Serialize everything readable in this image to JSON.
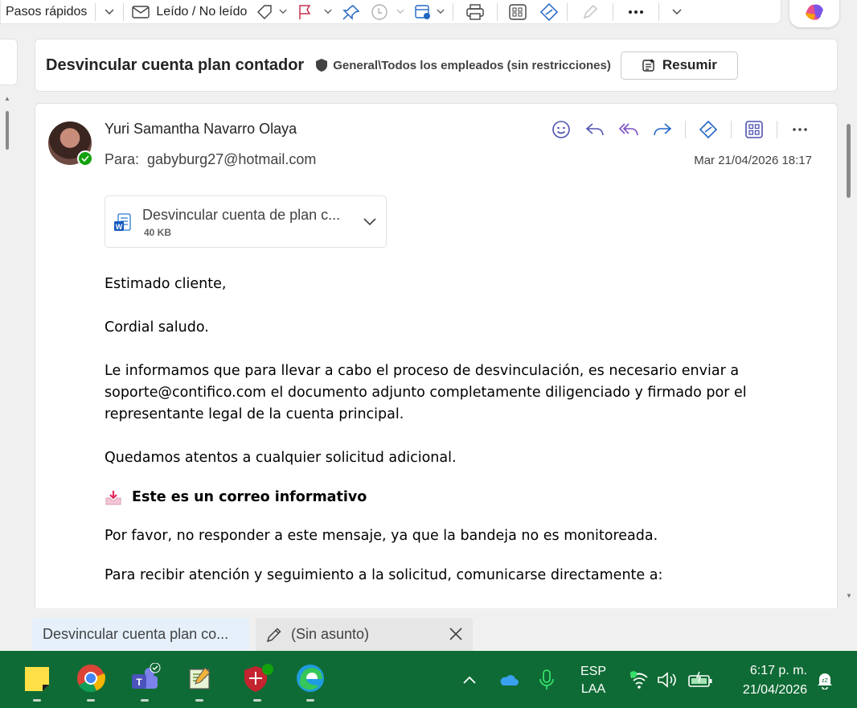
{
  "toolbar": {
    "quick_steps": "Pasos rápidos",
    "read_unread": "Leído / No leído"
  },
  "message": {
    "subject": "Desvincular cuenta plan contador",
    "sensitivity": "General\\Todos los empleados (sin restricciones)",
    "summarize_label": "Resumir",
    "sender": "Yuri Samantha Navarro Olaya",
    "to_label": "Para:",
    "to": "gabyburg27@hotmail.com",
    "date": "Mar 21/04/2026 18:17",
    "attachment": {
      "name": "Desvincular cuenta de plan c...",
      "size": "40 KB"
    },
    "body": {
      "greeting": "Estimado cliente,",
      "salutation": "Cordial saludo.",
      "para1": "Le informamos que para llevar a cabo el proceso de desvinculación, es necesario enviar a soporte@contifico.com el documento adjunto completamente diligenciado y firmado por el representante legal de la cuenta principal.",
      "para2": "Quedamos atentos a cualquier solicitud adicional.",
      "info_heading": "Este es un correo informativo",
      "para3": "Por favor, no responder a este mensaje, ya que la bandeja no es monitoreada.",
      "para4": "Para recibir atención y seguimiento a la solicitud, comunicarse directamente a:"
    }
  },
  "tabs": [
    {
      "label": "Desvincular cuenta plan co..."
    },
    {
      "label": "(Sin asunto)"
    }
  ],
  "taskbar": {
    "lang_top": "ESP",
    "lang_bottom": "LAA",
    "time": "6:17 p. m.",
    "date": "21/04/2026"
  },
  "colors": {
    "accent": "#4f52b2",
    "taskbar": "#0f6b35",
    "presence": "#13a10e"
  }
}
